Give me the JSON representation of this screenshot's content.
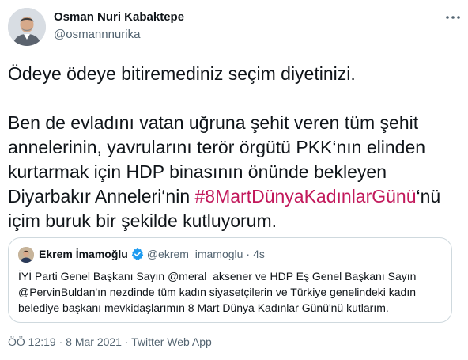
{
  "author": {
    "name": "Osman Nuri Kabaktepe",
    "handle": "@osmannnurika"
  },
  "tweet": {
    "line1": "Ödeye ödeye bitiremediniz seçim diyetinizi.",
    "para2_before": "Ben de evladını vatan uğruna şehit veren tüm şehit annelerinin, yavrularını terör örgütü PKK‘nın elinden kurtarmak için HDP binasının önünde bekleyen Diyarbakır Anneleri‘nin ",
    "hashtag": "#8MartDünyaKadınlarGünü",
    "para2_after": "‘nü içim buruk bir şekilde kutluyorum."
  },
  "quoted": {
    "name": "Ekrem İmamoğlu",
    "handle": "@ekrem_imamoglu",
    "separator": "·",
    "time": "4s",
    "text": "İYİ Parti Genel Başkanı Sayın @meral_aksener ve HDP Eş Genel Başkanı Sayın @PervinBuldan'ın nezdinde tüm kadın siyasetçilerin ve Türkiye genelindeki kadın belediye başkanı mevkidaşlarımın 8 Mart Dünya Kadınlar Günü'nü kutlarım."
  },
  "meta": "ÖÖ 12:19 · 8 Mar 2021 · Twitter Web App",
  "icons": {
    "more": "more-horizontal-icon",
    "verified": "verified-badge-icon"
  },
  "colors": {
    "hashtag": "#c2185b",
    "verified": "#1d9bf0",
    "secondary_text": "#536471",
    "border": "#cfd9de"
  }
}
